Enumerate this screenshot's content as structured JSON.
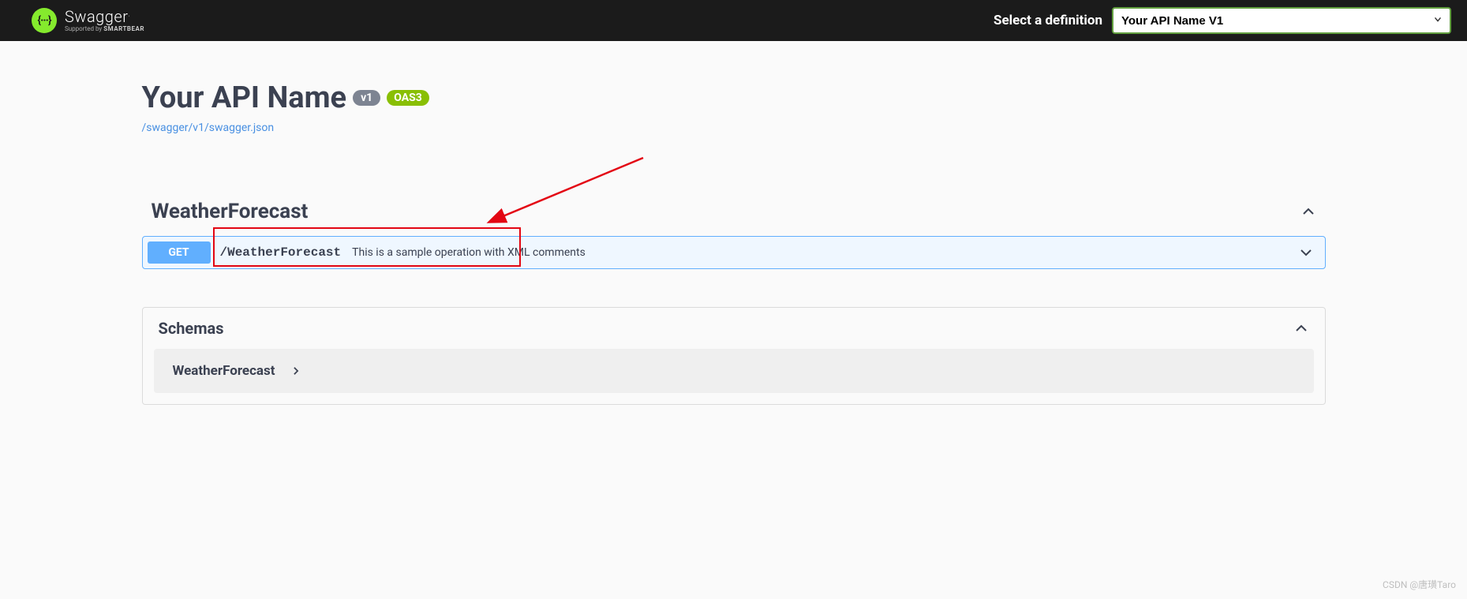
{
  "topbar": {
    "logo_braces": "{···}",
    "logo_name": "Swagger",
    "logo_dot": ".",
    "logo_sub_prefix": "Supported by ",
    "logo_sub_brand": "SMARTBEAR",
    "select_label": "Select a definition",
    "definition_selected": "Your API Name V1"
  },
  "info": {
    "title": "Your API Name",
    "version_badge": "v1",
    "oas_badge": "OAS3",
    "spec_url": "/swagger/v1/swagger.json"
  },
  "tag": {
    "name": "WeatherForecast"
  },
  "operation": {
    "method": "GET",
    "path": "/WeatherForecast",
    "summary": "This is a sample operation with XML comments"
  },
  "schemas": {
    "heading": "Schemas",
    "items": [
      {
        "name": "WeatherForecast"
      }
    ]
  },
  "watermark": "CSDN @唐璜Taro"
}
